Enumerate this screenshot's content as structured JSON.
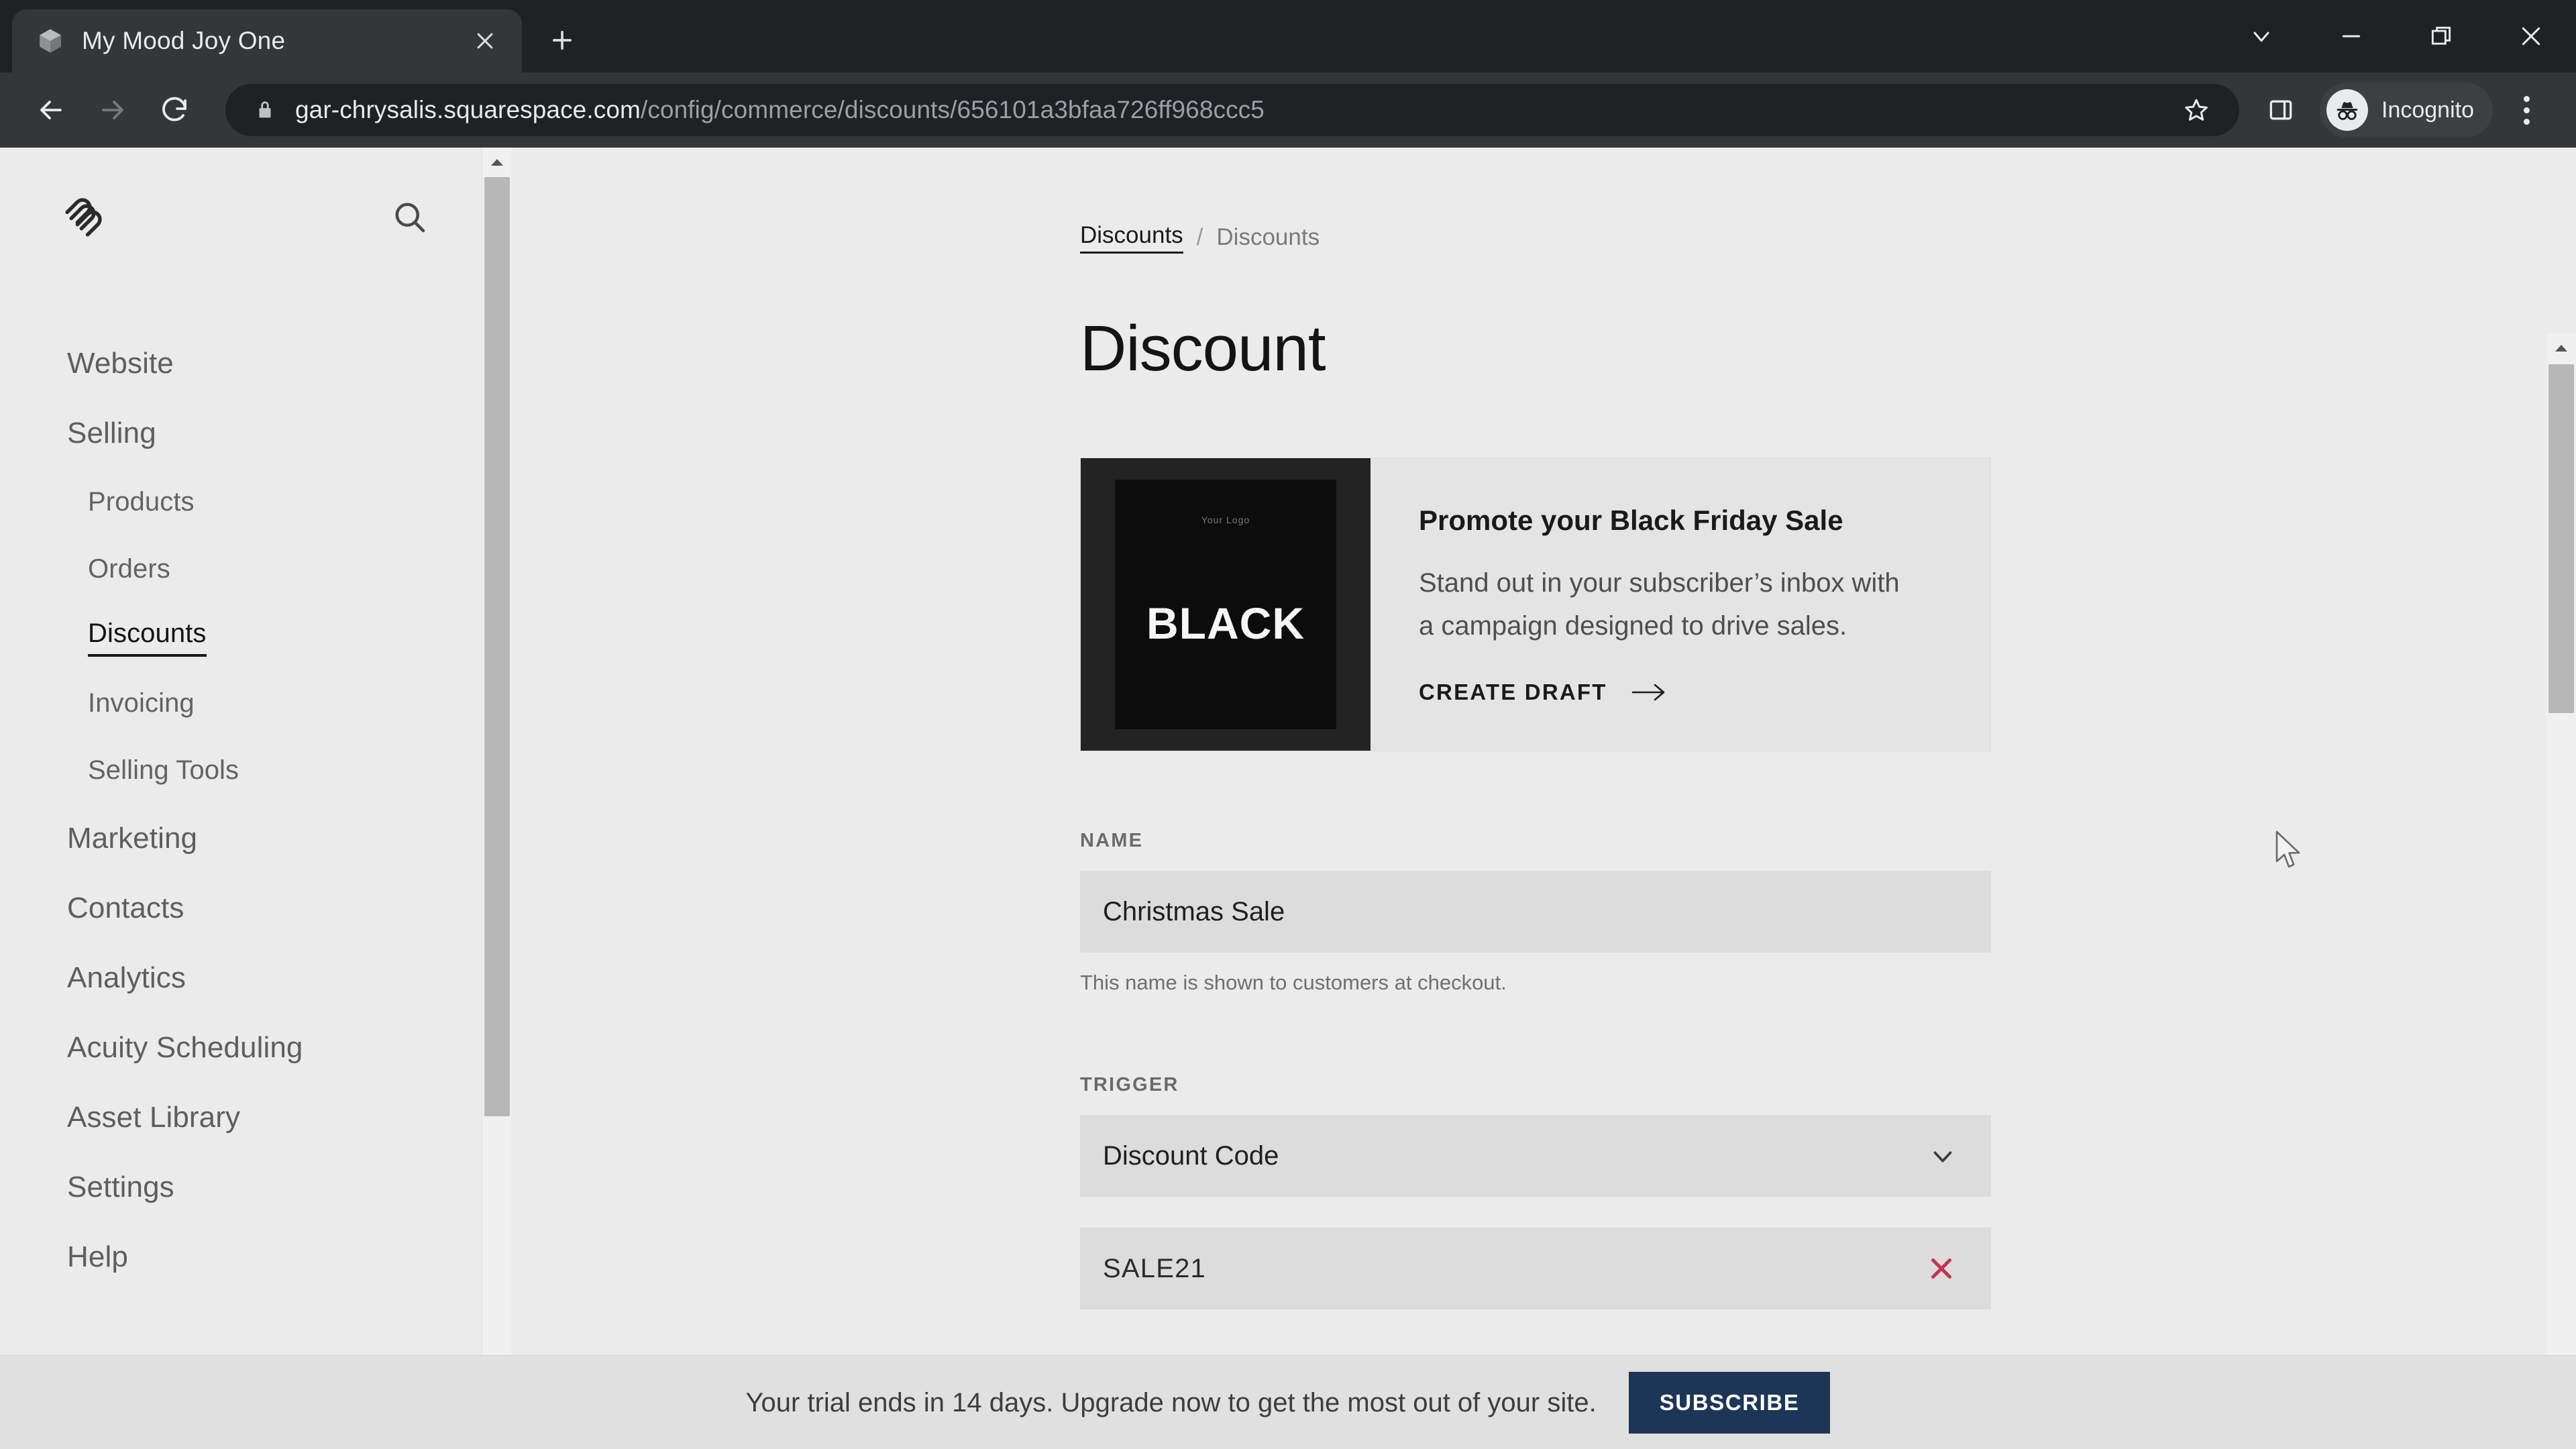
{
  "browser": {
    "tab": {
      "title": "My Mood Joy One",
      "favicon_icon": "cube-icon",
      "close_icon": "close-icon"
    },
    "new_tab_icon": "plus-icon",
    "window_controls": {
      "tab_search_icon": "chevron-down-icon",
      "minimize_icon": "minimize-icon",
      "restore_icon": "restore-icon",
      "close_icon": "window-close-icon"
    },
    "toolbar": {
      "back_icon": "arrow-left-icon",
      "forward_icon": "arrow-right-icon",
      "reload_icon": "reload-icon",
      "lock_icon": "lock-icon",
      "url_host": "gar-chrysalis.squarespace.com",
      "url_path": "/config/commerce/discounts/656101a3bfaa726ff968ccc5",
      "bookmark_icon": "star-icon",
      "side_panel_icon": "side-panel-icon",
      "profile_icon": "incognito-icon",
      "profile_label": "Incognito",
      "menu_icon": "three-dots-icon"
    }
  },
  "sidebar": {
    "logo_icon": "squarespace-logo-icon",
    "search_icon": "search-icon",
    "items": [
      {
        "label": "Website",
        "level": "top",
        "active": false
      },
      {
        "label": "Selling",
        "level": "top",
        "active": false
      },
      {
        "label": "Products",
        "level": "sub",
        "active": false
      },
      {
        "label": "Orders",
        "level": "sub",
        "active": false
      },
      {
        "label": "Discounts",
        "level": "sub",
        "active": true
      },
      {
        "label": "Invoicing",
        "level": "sub",
        "active": false
      },
      {
        "label": "Selling Tools",
        "level": "sub",
        "active": false
      },
      {
        "label": "Marketing",
        "level": "top",
        "active": false
      },
      {
        "label": "Contacts",
        "level": "top",
        "active": false
      },
      {
        "label": "Analytics",
        "level": "top",
        "active": false
      },
      {
        "label": "Acuity Scheduling",
        "level": "top",
        "active": false
      },
      {
        "label": "Asset Library",
        "level": "top",
        "active": false
      },
      {
        "label": "Settings",
        "level": "top",
        "active": false
      },
      {
        "label": "Help",
        "level": "top",
        "active": false
      }
    ]
  },
  "main": {
    "breadcrumb": {
      "parent": "Discounts",
      "separator": "/",
      "current": "Discounts"
    },
    "page_title": "Discount",
    "promo": {
      "thumb_micro_text": "Your Logo",
      "thumb_word": "BLACK",
      "heading": "Promote your Black Friday Sale",
      "body": "Stand out in your subscriber’s inbox with a campaign designed to drive sales.",
      "cta_label": "CREATE DRAFT",
      "cta_icon": "arrow-right-icon"
    },
    "name_field": {
      "label": "NAME",
      "value": "Christmas Sale",
      "help": "This name is shown to customers at checkout."
    },
    "trigger_field": {
      "label": "TRIGGER",
      "value": "Discount Code",
      "chevron_icon": "chevron-down-icon"
    },
    "code_field": {
      "value": "SALE21",
      "remove_icon": "close-x-icon",
      "remove_color": "#c4334f"
    }
  },
  "trial_banner": {
    "message": "Your trial ends in 14 days. Upgrade now to get the most out of your site.",
    "button_label": "SUBSCRIBE",
    "button_color": "#1d3557"
  },
  "cursor": {
    "icon": "arrow-cursor"
  }
}
